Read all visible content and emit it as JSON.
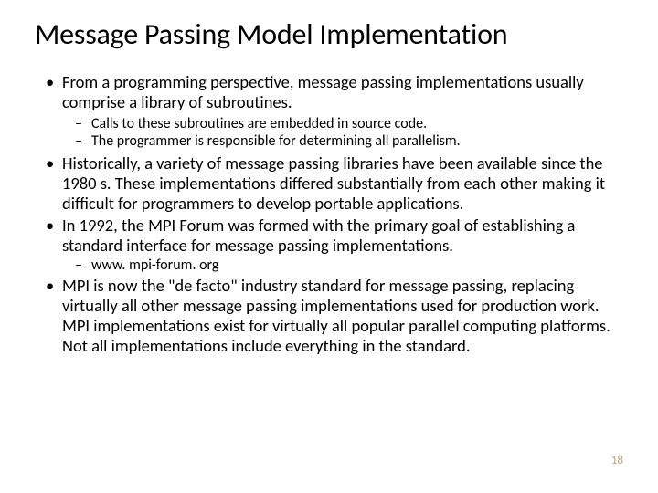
{
  "title": "Message Passing Model Implementation",
  "bullets": {
    "b1": "From a programming perspective, message passing implementations usually comprise a library of subroutines.",
    "b1_sub1": "Calls to these subroutines are embedded in source code.",
    "b1_sub2": "The programmer is responsible for determining all parallelism.",
    "b2": "Historically, a variety of message passing libraries have been available since the 1980 s. These implementations differed substantially from each other making it difficult for programmers to develop portable applications.",
    "b3": "In 1992, the MPI Forum was formed with the primary goal of establishing a standard interface for message passing implementations.",
    "b3_sub1": "www. mpi-forum. org",
    "b4": "MPI is now the \"de facto\" industry standard for message passing, replacing virtually all other message passing implementations used for production work. MPI implementations exist for virtually all popular parallel computing platforms. Not all implementations include everything in the standard."
  },
  "page_number": "18"
}
